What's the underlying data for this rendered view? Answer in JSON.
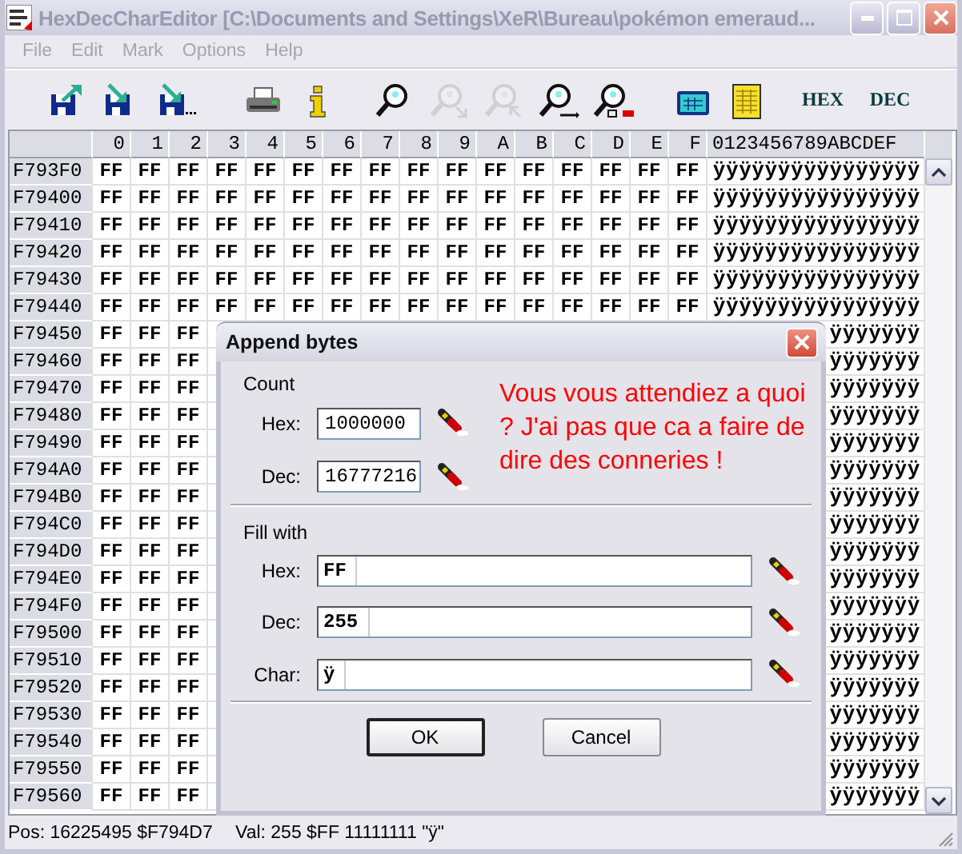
{
  "window": {
    "title": "HexDecCharEditor [C:\\Documents and Settings\\XeR\\Bureau\\pokémon emeraud..."
  },
  "menu": [
    {
      "label": "File",
      "disabled": true
    },
    {
      "label": "Edit",
      "disabled": true
    },
    {
      "label": "Mark",
      "disabled": true
    },
    {
      "label": "Options",
      "disabled": true
    },
    {
      "label": "Help",
      "disabled": true
    }
  ],
  "toolbar": [
    {
      "kind": "export",
      "disabled": false
    },
    {
      "kind": "import",
      "disabled": false
    },
    {
      "kind": "import-more",
      "disabled": false
    },
    {
      "kind": "print",
      "disabled": false
    },
    {
      "kind": "info",
      "disabled": false
    },
    {
      "kind": "search",
      "disabled": false
    },
    {
      "kind": "search-next",
      "disabled": true
    },
    {
      "kind": "search-prev",
      "disabled": true
    },
    {
      "kind": "replace",
      "disabled": false
    },
    {
      "kind": "replace-bytes",
      "disabled": false
    },
    {
      "kind": "calculator",
      "disabled": false
    },
    {
      "kind": "table",
      "disabled": false
    },
    {
      "kind": "label",
      "text": "HEX",
      "disabled": false
    },
    {
      "kind": "label",
      "text": "DEC",
      "disabled": false
    }
  ],
  "grid": {
    "columns": [
      "0",
      "1",
      "2",
      "3",
      "4",
      "5",
      "6",
      "7",
      "8",
      "9",
      "A",
      "B",
      "C",
      "D",
      "E",
      "F"
    ],
    "chars_header": "0123456789ABCDEF",
    "rows": [
      {
        "address": "F793F0",
        "cells": [
          "FF",
          "FF",
          "FF",
          "FF",
          "FF",
          "FF",
          "FF",
          "FF",
          "FF",
          "FF",
          "FF",
          "FF",
          "FF",
          "FF",
          "FF",
          "FF"
        ],
        "chars": "ÿÿÿÿÿÿÿÿÿÿÿÿÿÿÿÿ"
      },
      {
        "address": "F79400",
        "cells": [
          "FF",
          "FF",
          "FF",
          "FF",
          "FF",
          "FF",
          "FF",
          "FF",
          "FF",
          "FF",
          "FF",
          "FF",
          "FF",
          "FF",
          "FF",
          "FF"
        ],
        "chars": "ÿÿÿÿÿÿÿÿÿÿÿÿÿÿÿÿ"
      },
      {
        "address": "F79410",
        "cells": [
          "FF",
          "FF",
          "FF",
          "FF",
          "FF",
          "FF",
          "FF",
          "FF",
          "FF",
          "FF",
          "FF",
          "FF",
          "FF",
          "FF",
          "FF",
          "FF"
        ],
        "chars": "ÿÿÿÿÿÿÿÿÿÿÿÿÿÿÿÿ"
      },
      {
        "address": "F79420",
        "cells": [
          "FF",
          "FF",
          "FF",
          "FF",
          "FF",
          "FF",
          "FF",
          "FF",
          "FF",
          "FF",
          "FF",
          "FF",
          "FF",
          "FF",
          "FF",
          "FF"
        ],
        "chars": "ÿÿÿÿÿÿÿÿÿÿÿÿÿÿÿÿ"
      },
      {
        "address": "F79430",
        "cells": [
          "FF",
          "FF",
          "FF",
          "FF",
          "FF",
          "FF",
          "FF",
          "FF",
          "FF",
          "FF",
          "FF",
          "FF",
          "FF",
          "FF",
          "FF",
          "FF"
        ],
        "chars": "ÿÿÿÿÿÿÿÿÿÿÿÿÿÿÿÿ"
      },
      {
        "address": "F79440",
        "cells": [
          "FF",
          "FF",
          "FF",
          "FF",
          "FF",
          "FF",
          "FF",
          "FF",
          "FF",
          "FF",
          "FF",
          "FF",
          "FF",
          "FF",
          "FF",
          "FF"
        ],
        "chars": "ÿÿÿÿÿÿÿÿÿÿÿÿÿÿÿÿ"
      },
      {
        "address": "F79450",
        "cells": [
          "FF",
          "FF",
          "FF"
        ],
        "chars": "ÿÿÿÿÿÿÿ"
      },
      {
        "address": "F79460",
        "cells": [
          "FF",
          "FF",
          "FF"
        ],
        "chars": "ÿÿÿÿÿÿÿ"
      },
      {
        "address": "F79470",
        "cells": [
          "FF",
          "FF",
          "FF"
        ],
        "chars": "ÿÿÿÿÿÿÿ"
      },
      {
        "address": "F79480",
        "cells": [
          "FF",
          "FF",
          "FF"
        ],
        "chars": "ÿÿÿÿÿÿÿ"
      },
      {
        "address": "F79490",
        "cells": [
          "FF",
          "FF",
          "FF"
        ],
        "chars": "ÿÿÿÿÿÿÿ"
      },
      {
        "address": "F794A0",
        "cells": [
          "FF",
          "FF",
          "FF"
        ],
        "chars": "ÿÿÿÿÿÿÿ"
      },
      {
        "address": "F794B0",
        "cells": [
          "FF",
          "FF",
          "FF"
        ],
        "chars": "ÿÿÿÿÿÿÿ"
      },
      {
        "address": "F794C0",
        "cells": [
          "FF",
          "FF",
          "FF"
        ],
        "chars": "ÿÿÿÿÿÿÿ"
      },
      {
        "address": "F794D0",
        "cells": [
          "FF",
          "FF",
          "FF"
        ],
        "chars": "ÿÿÿÿÿÿÿ"
      },
      {
        "address": "F794E0",
        "cells": [
          "FF",
          "FF",
          "FF"
        ],
        "chars": "ÿÿÿÿÿÿÿ"
      },
      {
        "address": "F794F0",
        "cells": [
          "FF",
          "FF",
          "FF"
        ],
        "chars": "ÿÿÿÿÿÿÿ"
      },
      {
        "address": "F79500",
        "cells": [
          "FF",
          "FF",
          "FF"
        ],
        "chars": "ÿÿÿÿÿÿÿ"
      },
      {
        "address": "F79510",
        "cells": [
          "FF",
          "FF",
          "FF"
        ],
        "chars": "ÿÿÿÿÿÿÿ"
      },
      {
        "address": "F79520",
        "cells": [
          "FF",
          "FF",
          "FF"
        ],
        "chars": "ÿÿÿÿÿÿÿ"
      },
      {
        "address": "F79530",
        "cells": [
          "FF",
          "FF",
          "FF"
        ],
        "chars": "ÿÿÿÿÿÿÿ"
      },
      {
        "address": "F79540",
        "cells": [
          "FF",
          "FF",
          "FF"
        ],
        "chars": "ÿÿÿÿÿÿÿ"
      },
      {
        "address": "F79550",
        "cells": [
          "FF",
          "FF",
          "FF"
        ],
        "chars": "ÿÿÿÿÿÿÿ"
      },
      {
        "address": "F79560",
        "cells": [
          "FF",
          "FF",
          "FF"
        ],
        "chars": "ÿÿÿÿÿÿÿ"
      }
    ]
  },
  "dialog": {
    "title": "Append bytes",
    "groups": [
      {
        "label": "Count",
        "kind": "short",
        "fields": [
          {
            "label": "Hex:",
            "value": "1000000"
          },
          {
            "label": "Dec:",
            "value": "16777216"
          }
        ]
      },
      {
        "label": "Fill with",
        "kind": "wide",
        "fields": [
          {
            "label": "Hex:",
            "value": "FF"
          },
          {
            "label": "Dec:",
            "value": "255"
          },
          {
            "label": "Char:",
            "value": "ÿ"
          }
        ]
      }
    ],
    "buttons": [
      {
        "label": "OK",
        "default": true
      },
      {
        "label": "Cancel",
        "default": false
      }
    ]
  },
  "annotation": {
    "lines": [
      "Vous vous attendiez a quoi",
      "? J'ai pas que ca a faire de",
      "dire des conneries !"
    ]
  },
  "status_bar": {
    "position": "Pos: 16225495 $F794D7",
    "value": "Val: 255 $FF 11111111 \"ÿ\""
  }
}
